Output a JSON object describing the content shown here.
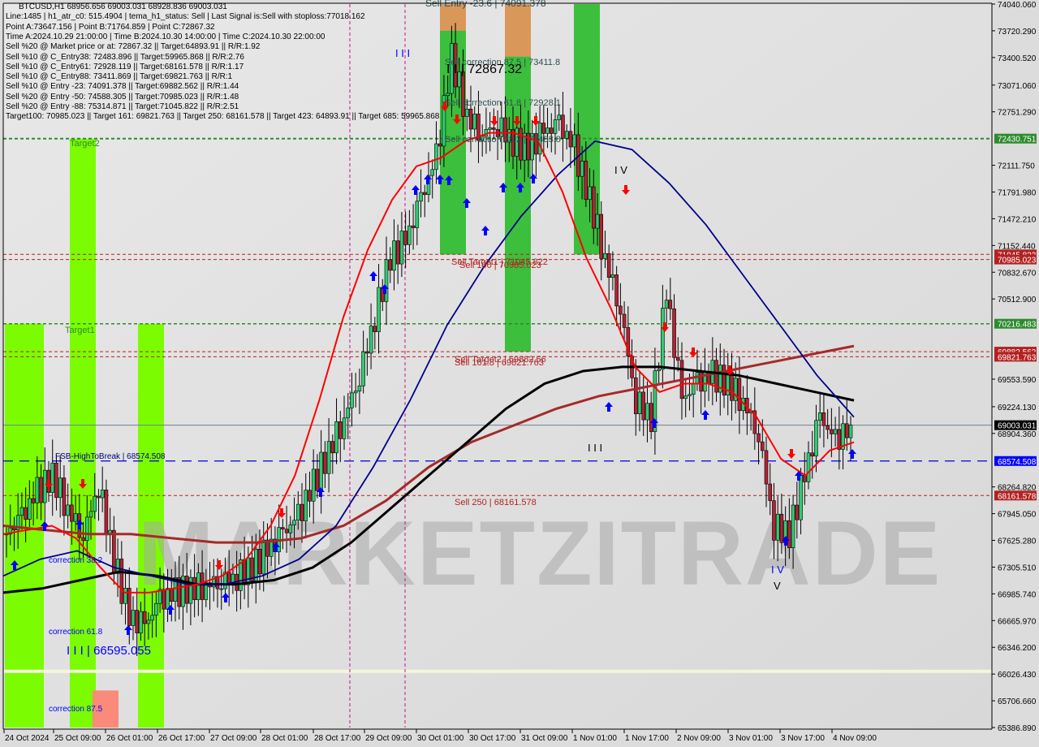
{
  "chart_data": {
    "type": "candlestick",
    "symbol": "BTCUSD",
    "timeframe": "H1",
    "title": "BTCUSD,H1  68956.656 69003.031 68928.836 69003.031",
    "ohlc_last": {
      "open": 68956.656,
      "high": 69003.031,
      "low": 68928.836,
      "close": 69003.031
    },
    "ylim": [
      65386.89,
      74040.06
    ],
    "y_ticks": [
      "74040.060",
      "73720.290",
      "73400.520",
      "73071.060",
      "72751.290",
      "72111.750",
      "71791.980",
      "71472.210",
      "71152.440",
      "70832.670",
      "70512.900",
      "69553.590",
      "69224.130",
      "68904.360",
      "68264.820",
      "67945.050",
      "67625.280",
      "67305.510",
      "66985.740",
      "66665.970",
      "66346.200",
      "66026.430",
      "65706.660",
      "65386.890"
    ],
    "x_ticks": [
      "24 Oct 2024",
      "25 Oct 09:00",
      "26 Oct 01:00",
      "26 Oct 17:00",
      "27 Oct 09:00",
      "28 Oct 01:00",
      "28 Oct 17:00",
      "29 Oct 09:00",
      "30 Oct 01:00",
      "30 Oct 17:00",
      "31 Oct 09:00",
      "1 Nov 01:00",
      "1 Nov 17:00",
      "2 Nov 09:00",
      "3 Nov 01:00",
      "3 Nov 17:00",
      "4 Nov 09:00"
    ],
    "price_tags": [
      {
        "value": 72430.751,
        "label": "72430.751",
        "color": "#2e8b2e"
      },
      {
        "value": 71045.822,
        "label": "71045.822",
        "color": "#b22222"
      },
      {
        "value": 70985.023,
        "label": "70985.023",
        "color": "#b22222"
      },
      {
        "value": 70216.483,
        "label": "70216.483",
        "color": "#2e8b2e"
      },
      {
        "value": 69882.562,
        "label": "69882.562",
        "color": "#b22222"
      },
      {
        "value": 69821.763,
        "label": "69821.763",
        "color": "#b22222"
      },
      {
        "value": 69003.031,
        "label": "69003.031",
        "color": "#000000"
      },
      {
        "value": 68574.508,
        "label": "68574.508",
        "color": "#0000ff"
      },
      {
        "value": 68161.578,
        "label": "68161.578",
        "color": "#b22222"
      }
    ],
    "info_lines": [
      "BTCUSD,H1  68956.656 69003.031 68928.836 69003.031",
      "Line:1485 | h1_atr_c0: 515.4904 | tema_h1_status: Sell | Last Signal is:Sell with stoploss:77018.162",
      "Point A:73647.156 | Point B:71764.859 | Point C:72867.32",
      "Time A:2024.10.29 21:00:00 | Time B:2024.10.30 14:00:00 | Time C:2024.10.30 22:00:00",
      "Sell %20 @ Market price or at: 72867.32 || Target:64893.91 || R/R:1.92",
      "Sell %10 @ C_Entry38: 72483.896 || Target:59965.868 || R/R:2.76",
      "Sell %10 @ C_Entry61: 72928.119 || Target:68161.578 || R/R:1.17",
      "Sell %10 @ C_Entry88: 73411.869 || Target:69821.763 || R/R:1",
      "Sell %10 @ Entry -23: 74091.378 || Target:69882.562 || R/R:1.44",
      "Sell %20 @ Entry -50: 74588.305 || Target:70985.023 || R/R:1.48",
      "Sell %20 @ Entry -88: 75314.871 || Target:71045.822 || R/R:2.51",
      "Target100: 70985.023 || Target 161: 69821.763 || Target 250: 68161.578 || Target 423: 64893.91 || Target 685: 59965.868"
    ],
    "annotations": [
      {
        "text": "Sell Entry -23.6 | 74091.378",
        "value": 74091.378,
        "color": "#2f4f4f"
      },
      {
        "text": "Sell correction 87.5 | 73411.8",
        "value": 73411.8,
        "color": "#2f4f4f"
      },
      {
        "text": "I I | 72867.32",
        "value": 72867.32,
        "color": "#000000"
      },
      {
        "text": "Sell correction 61.8 | 72928.1",
        "value": 72928.1,
        "color": "#2f4f4f"
      },
      {
        "text": "Sell correction 38.2 | 72483.8",
        "value": 72483.8,
        "color": "#2f4f4f"
      },
      {
        "text": "Sell Target1 | 71045.822",
        "value": 71045.822,
        "color": "#b22222"
      },
      {
        "text": "Sell 100 | 70985.023",
        "value": 70985.023,
        "color": "#b22222"
      },
      {
        "text": "Sell Target2 | 69882.56",
        "value": 69882.56,
        "color": "#b22222"
      },
      {
        "text": "Sell 161.8 | 69821.763",
        "value": 69821.763,
        "color": "#b22222"
      },
      {
        "text": "Sell 250 | 68161.578",
        "value": 68161.578,
        "color": "#b22222"
      },
      {
        "text": "FSB-HighToBreak | 68574.508",
        "value": 68574.508,
        "color": "#000080"
      },
      {
        "text": "correction 38.2",
        "value": 67440,
        "color": "#0000ff"
      },
      {
        "text": "correction 61.8",
        "value": 66790,
        "color": "#0000ff"
      },
      {
        "text": "I I I | 66595.055",
        "value": 66595.055,
        "color": "#0000ff"
      },
      {
        "text": "correction 87.5",
        "value": 65830,
        "color": "#0000ff"
      },
      {
        "text": "Target2",
        "value": 72430.751,
        "color": "#2e8b2e"
      },
      {
        "text": "Target1",
        "value": 70216.483,
        "color": "#2e8b2e"
      },
      {
        "text": "I I I",
        "value": 73720,
        "color": "#0000ff"
      },
      {
        "text": "I V",
        "value": 72111,
        "color": "#000000"
      },
      {
        "text": "I I I",
        "value": 68930,
        "color": "#000000"
      },
      {
        "text": "I V",
        "value": 67250,
        "color": "#0000ff"
      },
      {
        "text": "V",
        "value": 67060,
        "color": "#000000"
      }
    ],
    "watermark": "MARKETZITRADE",
    "colors": {
      "bull": "#2ecc71",
      "bear": "#b22234",
      "ema_fast": "#ff0000",
      "ma_blue": "#00008b",
      "ma_black": "#000000",
      "ma_brown": "#a52a2a",
      "green_zone": "#7cfc00",
      "dark_green_zone": "#3cbf3c",
      "orange_zone": "#d9985a",
      "salmon_zone": "#fa8a7a"
    },
    "series": [
      {
        "name": "price_close_approx",
        "values": [
          67700,
          67900,
          68200,
          68400,
          68000,
          67700,
          68300,
          67400,
          66700,
          66600,
          66900,
          67000,
          67050,
          67100,
          67150,
          67200,
          67300,
          67500,
          67700,
          67900,
          68300,
          68700,
          69100,
          69600,
          70300,
          71000,
          71200,
          71700,
          72200,
          73400,
          72700,
          72500,
          72600,
          72400,
          72300,
          72500,
          72600,
          72300,
          71700,
          71000,
          70400,
          69300,
          69100,
          70600,
          69300,
          69500,
          69600,
          69500,
          69300,
          68900,
          67800,
          67700,
          68400,
          69100,
          68800,
          69003
        ]
      },
      {
        "name": "ema_red",
        "values": [
          67700,
          67750,
          67800,
          67650,
          67300,
          67000,
          67000,
          67050,
          67100,
          67200,
          67400,
          67800,
          68400,
          69300,
          70300,
          71100,
          71700,
          72100,
          72200,
          72400,
          72500,
          72500,
          72400,
          71800,
          71000,
          70400,
          69700,
          69400,
          69500,
          69500,
          69400,
          69100,
          68600,
          68400,
          68700,
          68800
        ]
      },
      {
        "name": "ma_blue",
        "values": [
          67200,
          67400,
          67500,
          67300,
          67200,
          67100,
          67100,
          67200,
          67400,
          67800,
          68500,
          69300,
          70200,
          70900,
          71500,
          72000,
          72400,
          72300,
          71900,
          71400,
          70800,
          70200,
          69600,
          69100
        ]
      },
      {
        "name": "ma_black",
        "values": [
          67000,
          67050,
          67150,
          67250,
          67200,
          67100,
          67100,
          67150,
          67300,
          67600,
          68000,
          68400,
          68800,
          69200,
          69500,
          69650,
          69700,
          69700,
          69650,
          69600,
          69500,
          69400,
          69300
        ]
      },
      {
        "name": "ma_brown",
        "values": [
          67800,
          67750,
          67700,
          67700,
          67650,
          67600,
          67600,
          67650,
          67800,
          68100,
          68500,
          68800,
          69000,
          69200,
          69350,
          69450,
          69550,
          69650,
          69750,
          69850,
          69950
        ]
      }
    ]
  }
}
